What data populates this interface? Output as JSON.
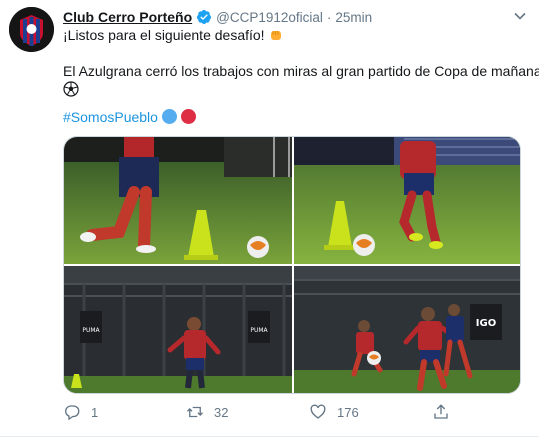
{
  "tweet": {
    "author_name": "Club Cerro Porteño",
    "handle": "@CCP1912oficial",
    "separator": "·",
    "time": "25min",
    "line1": "¡Listos para el siguiente desafío!",
    "line2": "El Azulgrana cerró los trabajos con miras al gran partido de Copa de mañana",
    "hashtag": "#SomosPueblo",
    "emoji_circle_colors": [
      "#55acee",
      "#dd2e44"
    ],
    "photos": [
      {
        "name": "photo-1",
        "description": "player-legs-cone-ball"
      },
      {
        "name": "photo-2",
        "description": "player-dribbling-cone"
      },
      {
        "name": "photo-3",
        "description": "player-training-night"
      },
      {
        "name": "photo-4",
        "description": "players-running-ball"
      }
    ],
    "brand_text": "PUMA",
    "sign_text": "IGO",
    "counts": {
      "reply": "1",
      "retweet": "32",
      "like": "176"
    }
  },
  "colors": {
    "accent": "#1b95e0",
    "muted": "#657786",
    "verified": "#1da1f2"
  },
  "icons": [
    "caret-down-icon",
    "verified-icon",
    "reply-icon",
    "retweet-icon",
    "like-icon",
    "share-icon",
    "fist-icon",
    "soccer-ball-icon"
  ]
}
